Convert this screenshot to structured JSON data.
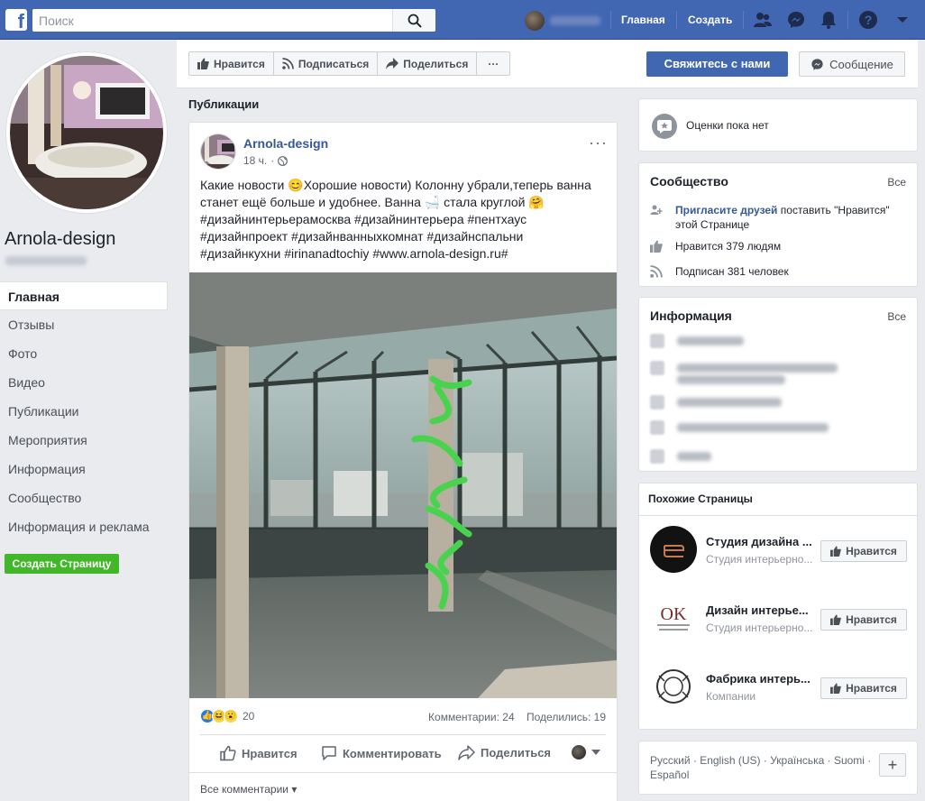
{
  "topbar": {
    "search_placeholder": "Поиск",
    "nav_home": "Главная",
    "nav_create": "Создать"
  },
  "left": {
    "page_name": "Arnola-design",
    "nav": [
      "Главная",
      "Отзывы",
      "Фото",
      "Видео",
      "Публикации",
      "Мероприятия",
      "Информация",
      "Сообщество",
      "Информация и реклама"
    ],
    "create_page": "Создать Страницу"
  },
  "actions": {
    "like": "Нравится",
    "follow": "Подписаться",
    "share": "Поделиться",
    "more": "···",
    "contact": "Свяжитесь с нами",
    "message": "Сообщение"
  },
  "posts": {
    "section_title": "Публикации",
    "post": {
      "author": "Arnola-design",
      "time": "18 ч.",
      "more": "···",
      "text_lines": [
        "Какие новости 😊Хорошие новости) Колонну убрали,теперь ванна",
        "станет ещё больше и удобнее. Ванна 🛁 стала круглой 🤗",
        "#дизайнинтерьерамосква #дизайнинтерьера #пентхаус",
        "#дизайнпроект #дизайнванныхкомнат #дизайнспальни",
        "#дизайнкухни #irinanadtochiy #www.arnola-design.ru#"
      ],
      "reactions_count": "20",
      "comments": "Комментарии: 24",
      "shares": "Поделились: 19",
      "action_like": "Нравится",
      "action_comment": "Комментировать",
      "action_share": "Поделиться",
      "all_comments": "Все комментарии ▾"
    }
  },
  "right": {
    "rating_text": "Оценки пока нет",
    "community": {
      "title": "Сообщество",
      "all": "Все",
      "invite_link": "Пригласите друзей",
      "invite_rest": " поставить \"Нравится\"",
      "invite_line2": "этой Странице",
      "likes": "Нравится 379 людям",
      "followers": "Подписан 381 человек"
    },
    "info": {
      "title": "Информация",
      "all": "Все"
    },
    "similar": {
      "title": "Похожие Страницы",
      "like_label": "Нравится",
      "items": [
        {
          "name": "Студия дизайна ...",
          "category": "Студия интерьерно..."
        },
        {
          "name": "Дизайн интерье...",
          "category": "Студия интерьерно..."
        },
        {
          "name": "Фабрика интерь...",
          "category": "Компании"
        }
      ]
    },
    "languages": {
      "line1": "Русский · English (US) · Українська · Suomi ·",
      "line2": "Español",
      "plus": "+"
    }
  },
  "colors": {
    "brand": "#4267b2",
    "link": "#365899",
    "green": "#42b72a"
  }
}
